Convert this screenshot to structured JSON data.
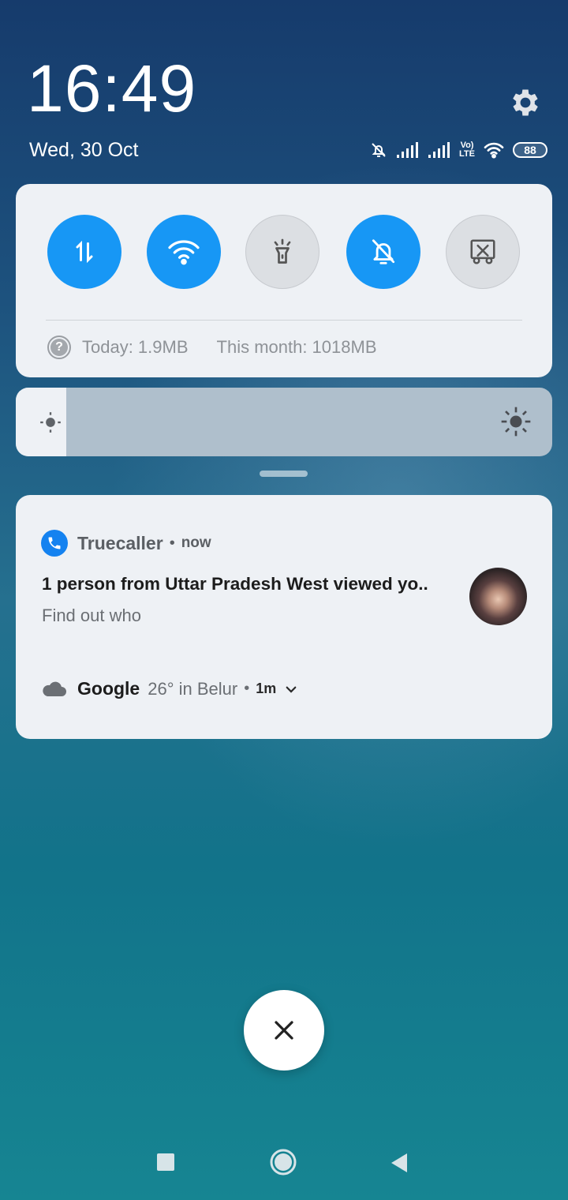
{
  "status": {
    "time": "16:49",
    "date": "Wed, 30 Oct",
    "battery": "88",
    "icons": [
      "mute-icon",
      "signal-1-icon",
      "signal-2-icon",
      "volte-icon",
      "wifi-icon",
      "battery-icon"
    ],
    "volte_label_top": "Vo)",
    "volte_label_bottom": "LTE"
  },
  "quick_settings": {
    "tiles": [
      {
        "name": "mobile-data",
        "icon": "data-transfer-icon",
        "active": true
      },
      {
        "name": "wifi",
        "icon": "wifi-icon",
        "active": true
      },
      {
        "name": "flashlight",
        "icon": "flashlight-icon",
        "active": false
      },
      {
        "name": "silent",
        "icon": "bell-off-icon",
        "active": true
      },
      {
        "name": "screenshot",
        "icon": "screenshot-icon",
        "active": false
      }
    ],
    "usage_today": "Today: 1.9MB",
    "usage_month": "This month: 1018MB",
    "usage_help": "?"
  },
  "brightness": {
    "level": 0.0
  },
  "notifications": {
    "truecaller": {
      "app": "Truecaller",
      "time": "now",
      "separator": "•",
      "title": "1 person from Uttar Pradesh West viewed yo..",
      "body": "Find out who"
    },
    "google": {
      "app": "Google",
      "summary": "26° in Belur",
      "separator": "•",
      "time": "1m"
    }
  },
  "colors": {
    "accent": "#1797f5",
    "truecaller": "#1482f0",
    "panel": "#eef1f5"
  }
}
